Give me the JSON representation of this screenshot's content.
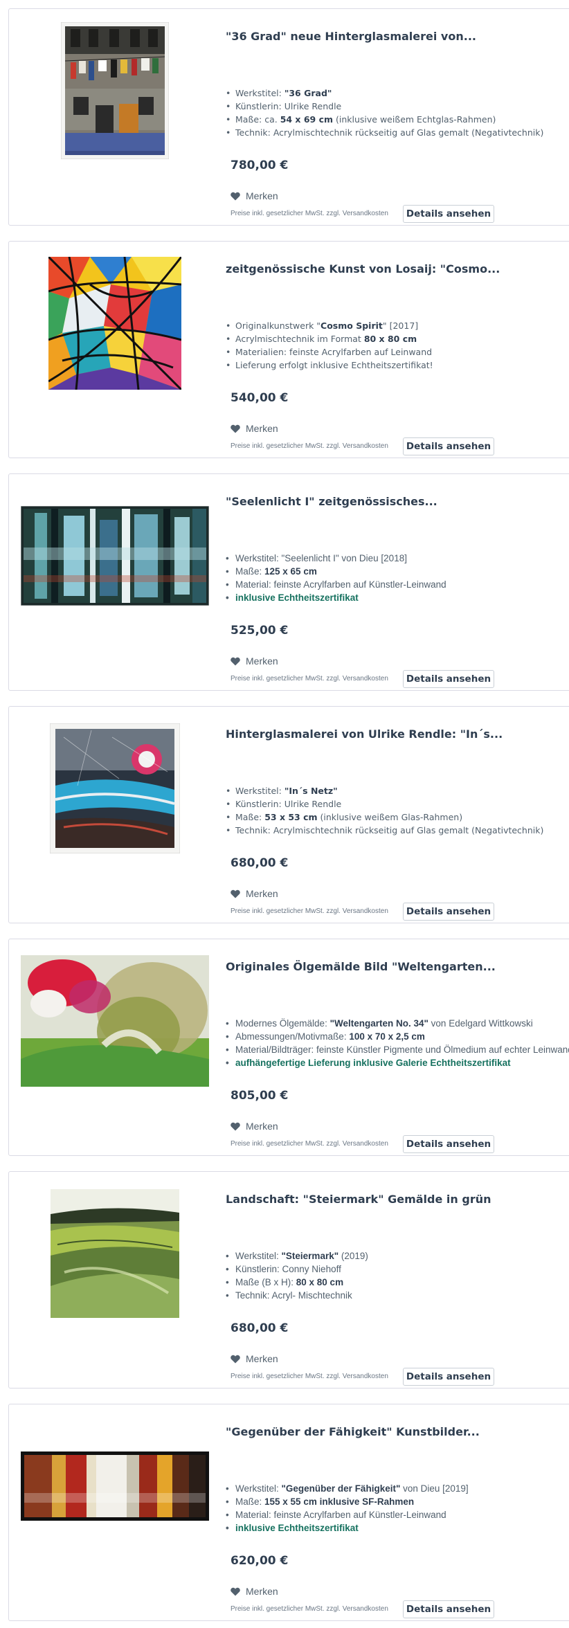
{
  "common": {
    "merken_label": "Merken",
    "legal_text": "Preise inkl. gesetzlicher MwSt. zzgl. Versandkosten",
    "details_label": "Details ansehen"
  },
  "products": [
    {
      "title": "\"36 Grad\" neue Hinterglasmalerei von...",
      "props": [
        {
          "pre": "Werkstitel: ",
          "bold": "\"36 Grad\"",
          "post": ""
        },
        {
          "pre": "Künstlerin: Ulrike Rendle",
          "bold": "",
          "post": ""
        },
        {
          "pre": "Maße: ca. ",
          "bold": "54 x 69 cm",
          "post": " (inklusive weißem Echtglas-Rahmen)"
        },
        {
          "pre": "Technik: Acrylmischtechnik rückseitig auf Glas gemalt (Negativtechnik)",
          "bold": "",
          "post": ""
        }
      ],
      "price": "780,00 €"
    },
    {
      "title": "zeitgenössische Kunst von Losaij: \"Cosmo...",
      "props": [
        {
          "pre": "Originalkunstwerk \"",
          "bold": "Cosmo Spirit",
          "post": "\" [2017]"
        },
        {
          "pre": "Acrylmischtechnik im Format ",
          "bold": "80 x 80 cm",
          "post": ""
        },
        {
          "pre": "Materialien: feinste Acrylfarben auf Leinwand",
          "bold": "",
          "post": ""
        },
        {
          "pre": "Lieferung erfolgt inklusive Echtheitszertifikat!",
          "bold": "",
          "post": ""
        }
      ],
      "price": "540,00 €"
    },
    {
      "title": "\"Seelenlicht I\" zeitgenössisches...",
      "props": [
        {
          "pre": "Werkstitel: \"Seelenlicht I\" von Dieu [2018]",
          "bold": "",
          "post": ""
        },
        {
          "pre": "Maße: ",
          "bold": "125 x 65 cm",
          "post": ""
        },
        {
          "pre": "Material: feinste Acrylfarben auf Künstler-Leinwand",
          "bold": "",
          "post": ""
        },
        {
          "pre": "inklusive Echtheitszertifikat",
          "bold": "",
          "post": "",
          "green": true
        }
      ],
      "price": "525,00 €"
    },
    {
      "title": "Hinterglasmalerei von Ulrike Rendle: \"In´s...",
      "props": [
        {
          "pre": "Werkstitel: ",
          "bold": "\"In´s Netz\"",
          "post": ""
        },
        {
          "pre": "Künstlerin: Ulrike Rendle",
          "bold": "",
          "post": ""
        },
        {
          "pre": "Maße: ",
          "bold": "53 x 53 cm",
          "post": " (inklusive weißem Glas-Rahmen)"
        },
        {
          "pre": "Technik: Acrylmischtechnik rückseitig auf Glas gemalt (Negativtechnik)",
          "bold": "",
          "post": ""
        }
      ],
      "price": "680,00 €"
    },
    {
      "title": "Originales Ölgemälde Bild \"Weltengarten...",
      "props": [
        {
          "pre": "Modernes Ölgemälde: ",
          "bold": "\"Weltengarten No. 34\"",
          "post": " von Edelgard Wittkowski"
        },
        {
          "pre": "Abmessungen/Motivmaße: ",
          "bold": "100 x 70 x 2,5 cm",
          "post": ""
        },
        {
          "pre": "Material/Bildträger: feinste Künstler Pigmente und Ölmedium auf echter Leinwand",
          "bold": "",
          "post": ""
        },
        {
          "pre": "aufhängefertige Lieferung inklusive Galerie Echtheitszertifikat",
          "bold": "",
          "post": "",
          "green": true
        }
      ],
      "price": "805,00 €"
    },
    {
      "title": "Landschaft: \"Steiermark\" Gemälde in grün",
      "props": [
        {
          "pre": "Werkstitel: ",
          "bold": "\"Steiermark\"",
          "post": " (2019)"
        },
        {
          "pre": "Künstlerin: Conny Niehoff",
          "bold": "",
          "post": ""
        },
        {
          "pre": "Maße (B x H): ",
          "bold": "80 x 80 cm",
          "post": ""
        },
        {
          "pre": "Technik: Acryl- Mischtechnik",
          "bold": "",
          "post": ""
        }
      ],
      "price": "680,00 €"
    },
    {
      "title": "\"Gegenüber der Fähigkeit\" Kunstbilder...",
      "props": [
        {
          "pre": "Werkstitel: ",
          "bold": "\"Gegenüber der Fähigkeit\"",
          "post": " von Dieu [2019]"
        },
        {
          "pre": "Maße: ",
          "bold": "155 x 55 cm inklusive SF-Rahmen",
          "post": ""
        },
        {
          "pre": "Material: feinste Acrylfarben auf Künstler-Leinwand",
          "bold": "",
          "post": ""
        },
        {
          "pre": "inklusive Echtheitszertifikat",
          "bold": "",
          "post": "",
          "green": true
        }
      ],
      "price": "620,00 €"
    }
  ]
}
